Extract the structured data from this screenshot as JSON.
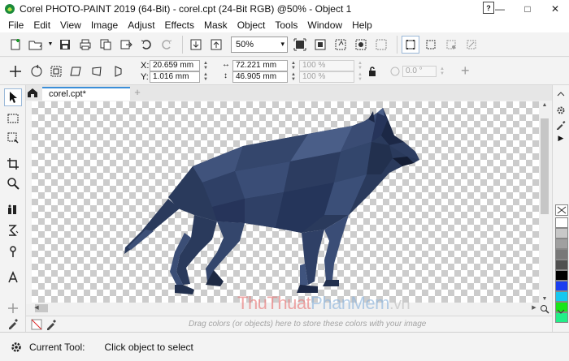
{
  "window": {
    "title": "Corel PHOTO-PAINT 2019 (64-Bit) - corel.cpt (24-Bit RGB) @50% - Object 1",
    "help_icon": "help-icon",
    "minimize": "—",
    "maximize": "□",
    "close": "✕"
  },
  "menu": [
    "File",
    "Edit",
    "View",
    "Image",
    "Adjust",
    "Effects",
    "Mask",
    "Object",
    "Tools",
    "Window",
    "Help"
  ],
  "standard_toolbar": {
    "zoom_value": "50%",
    "zoom_arrow": "▾",
    "buttons": [
      "new-icon",
      "open-icon",
      "save-icon",
      "print-icon",
      "import-icon",
      "export-icon",
      "undo-icon",
      "redo-icon",
      "send-back-icon",
      "bring-front-icon",
      "zoom-fit-icon",
      "zoom-100-icon"
    ]
  },
  "property_bar": {
    "x_label": "X:",
    "x_value": "20.659 mm",
    "y_label": "Y:",
    "y_value": "1.016 mm",
    "w_value": "72.221 mm",
    "h_value": "46.905 mm",
    "scale_x": "100 %",
    "scale_y": "100 %",
    "rotation": "0.0 °",
    "plus": "+"
  },
  "document": {
    "tab_label": "corel.cpt*",
    "add_tab": "+"
  },
  "status": {
    "tool_label": "Current Tool:",
    "tool_message": "Click object to select"
  },
  "color_strip": {
    "hint": "Drag colors (or objects) here to store these colors with your image"
  },
  "watermark": {
    "part1": "ThuThuat",
    "part2": "PhanMem",
    "part3": ".vn"
  },
  "palette": {
    "colors": [
      "#ffffff",
      "#c8c8c8",
      "#a0a0a0",
      "#787878",
      "#505050",
      "#000000",
      "#1a3ef0",
      "#16c8f0",
      "#19e619",
      "#22ee88"
    ]
  },
  "colors": {
    "wolf_dark": "#1e2a44",
    "wolf_mid": "#34456a",
    "wolf_light": "#4b5f8a",
    "accent": "#3b8ed8"
  }
}
